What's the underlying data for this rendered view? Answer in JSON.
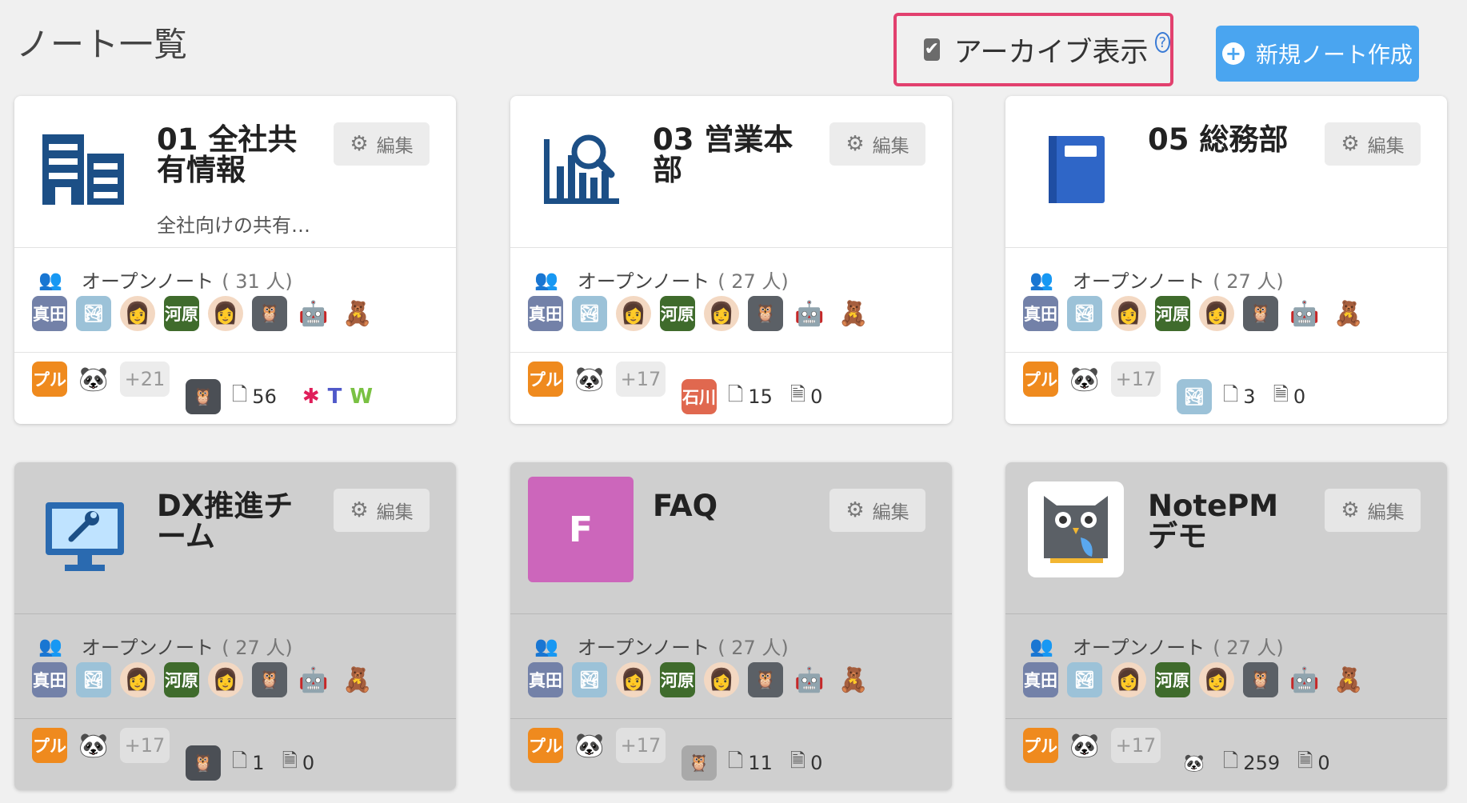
{
  "page": {
    "title": "ノート一覧"
  },
  "archive": {
    "checked_mark": "✔",
    "label": "アーカイブ表示",
    "help": "?"
  },
  "new_note": {
    "plus": "+",
    "label": "新規ノート作成"
  },
  "common": {
    "edit_icon": "⚙",
    "edit_label": "編集",
    "people_icon": "👥",
    "open_label": "オープンノート",
    "person_icon": "👤",
    "doc_icon": "🗋",
    "draft_icon": "🗎"
  },
  "avatar_row": {
    "sanada": "真田",
    "photo": "🏞",
    "face1": "👩",
    "kawahara": "河原",
    "face2": "👩",
    "owl": "🦉",
    "robot": "🤖",
    "bear": "🧸",
    "puru": "プル",
    "panda": "🐼"
  },
  "cards": [
    {
      "title": "01 全社共有情報",
      "description": "全社向けの共有…",
      "logo": "building-icon",
      "member_count": "( 31 人)",
      "more": "+21",
      "stat_avatar": "🦉",
      "stat_avatar_color": "#4b4f55",
      "notes": "56",
      "drafts": "",
      "apps": [
        "slack-icon",
        "teams-icon",
        "w-icon"
      ],
      "app_glyphs": [
        "✱",
        "T",
        "W"
      ],
      "archived": false
    },
    {
      "title": "03 営業本部",
      "description": "",
      "logo": "chart-search-icon",
      "member_count": "( 27 人)",
      "more": "+17",
      "stat_avatar": "石川",
      "stat_avatar_color": "#e0684f",
      "notes": "15",
      "drafts": "0",
      "archived": false
    },
    {
      "title": "05 総務部",
      "description": "",
      "logo": "notebook-icon",
      "member_count": "( 27 人)",
      "more": "+17",
      "stat_avatar": "🏞",
      "stat_avatar_color": "#9cc2d8",
      "notes": "3",
      "drafts": "0",
      "archived": false
    },
    {
      "title": "DX推進チーム",
      "description": "",
      "logo": "monitor-wrench-icon",
      "member_count": "( 27 人)",
      "more": "+17",
      "stat_avatar": "🦉",
      "stat_avatar_color": "#4b4f55",
      "notes": "1",
      "drafts": "0",
      "archived": true
    },
    {
      "title": "FAQ",
      "description": "",
      "logo": "letter-f",
      "logo_letter": "F",
      "logo_color": "#cc66bb",
      "member_count": "( 27 人)",
      "more": "+17",
      "stat_avatar": "🦉",
      "stat_avatar_color": "#a9a9a9",
      "notes": "11",
      "drafts": "0",
      "archived": true
    },
    {
      "title": "NotePMデモ",
      "description": "",
      "logo": "owl-icon",
      "member_count": "( 27 人)",
      "more": "+17",
      "stat_avatar": "🐼",
      "stat_avatar_color": "transparent",
      "notes": "259",
      "drafts": "0",
      "archived": true
    }
  ]
}
